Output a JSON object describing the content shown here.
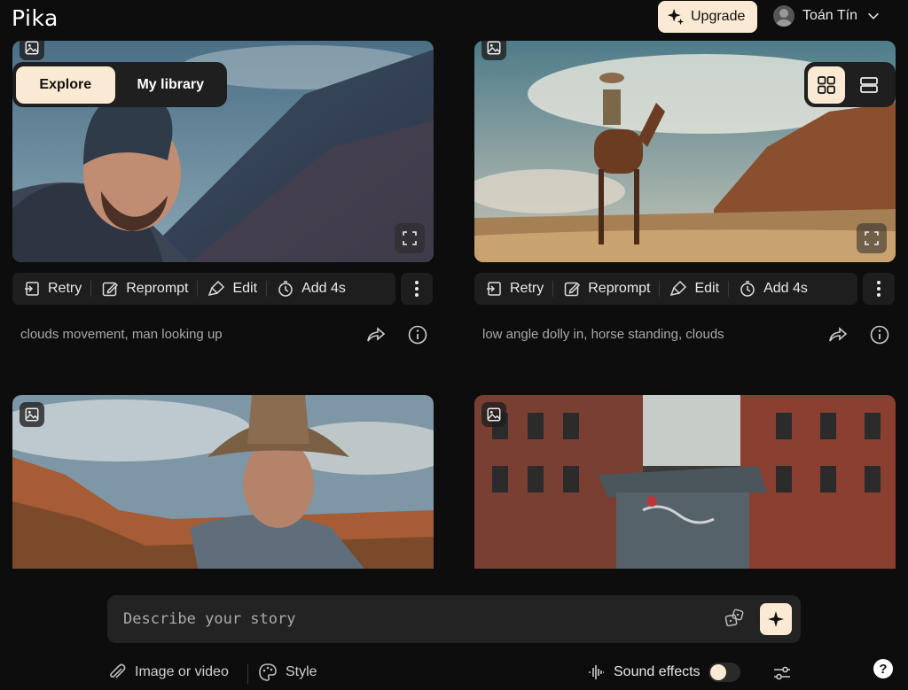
{
  "app": {
    "logo": "Pika",
    "upgrade_label": "Upgrade",
    "user_name": "Toán Tín"
  },
  "tabs": [
    {
      "label": "Explore",
      "active": true
    },
    {
      "label": "My library",
      "active": false
    }
  ],
  "view_toggle": {
    "active": "grid"
  },
  "colors": {
    "accent": "#fbead3",
    "background": "#0d0d0d",
    "panel": "#1e1e1e"
  },
  "toolbar": {
    "retry": "Retry",
    "reprompt": "Reprompt",
    "edit": "Edit",
    "add4s": "Add 4s"
  },
  "cards": [
    {
      "caption": "clouds movement, man looking up",
      "thumbnail": "man in beanie, mountains"
    },
    {
      "caption": "low angle dolly in, horse standing, clouds",
      "thumbnail": "cowboy on horse, desert"
    },
    {
      "caption": "",
      "thumbnail": "cowboy in hat, canyon"
    },
    {
      "caption": "",
      "thumbnail": "trash bin in alley"
    }
  ],
  "prompt": {
    "placeholder": "Describe your story"
  },
  "options": {
    "image_or_video": "Image or video",
    "style": "Style",
    "sound_effects": "Sound effects",
    "sound_effects_on": false
  },
  "help_label": "?"
}
